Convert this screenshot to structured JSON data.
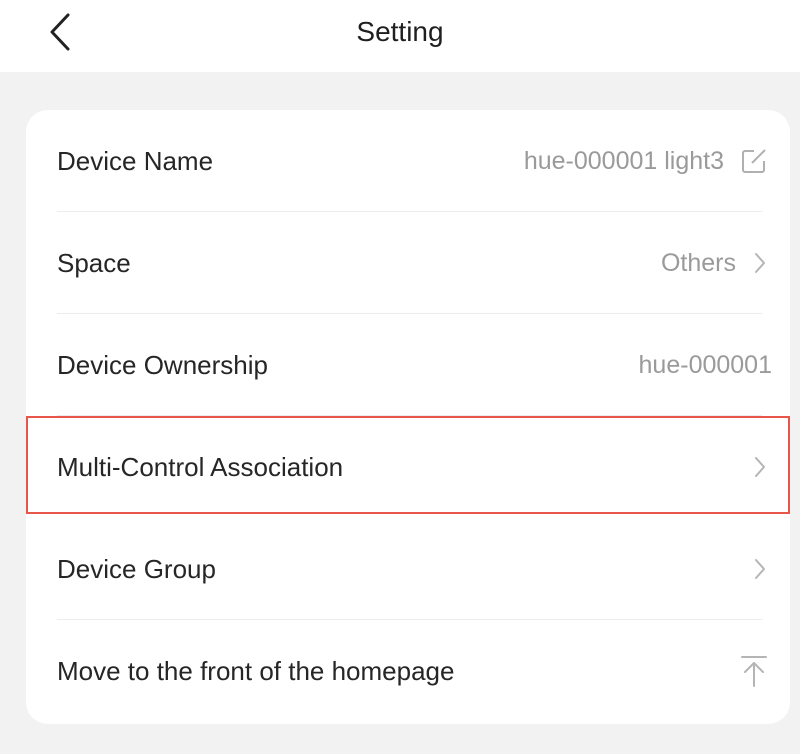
{
  "header": {
    "title": "Setting"
  },
  "settings": {
    "items": [
      {
        "label": "Device Name",
        "value": "hue-000001 light3",
        "icon": "edit-icon"
      },
      {
        "label": "Space",
        "value": "Others",
        "icon": "chevron-right-icon"
      },
      {
        "label": "Device Ownership",
        "value": "hue-000001",
        "icon": ""
      },
      {
        "label": "Multi-Control Association",
        "value": "",
        "icon": "chevron-right-icon"
      },
      {
        "label": "Device Group",
        "value": "",
        "icon": "chevron-right-icon"
      },
      {
        "label": "Move to the front of the homepage",
        "value": "",
        "icon": "move-to-top-icon"
      }
    ]
  },
  "colors": {
    "highlight": "#e8564a",
    "background": "#f2f2f3",
    "muted_text": "#9a9a9a"
  }
}
